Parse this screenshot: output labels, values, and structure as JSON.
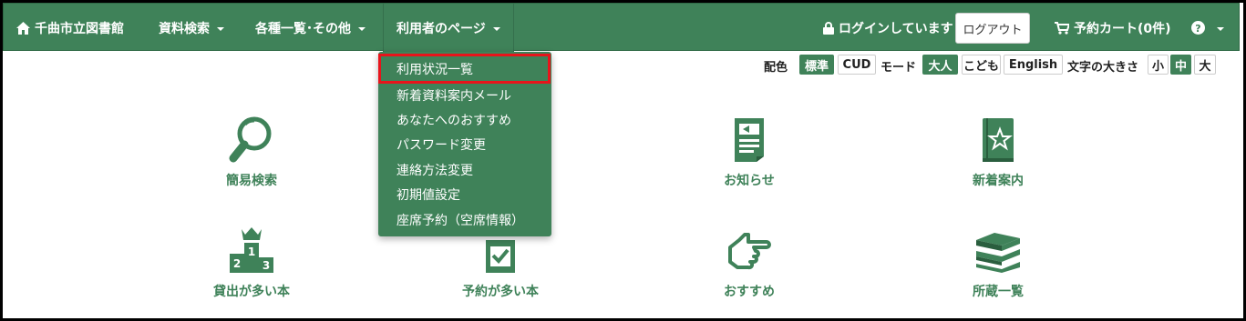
{
  "navbar": {
    "home_label": "千曲市立図書館",
    "menu_search": "資料検索",
    "menu_lists": "各種一覧･その他",
    "menu_user_page": "利用者のページ",
    "login_status": "ログインしています",
    "logout_label": "ログアウト",
    "cart_label": "予約カート(0件)"
  },
  "dropdown": {
    "items": [
      {
        "label": "利用状況一覧"
      },
      {
        "label": "新着資料案内メール"
      },
      {
        "label": "あなたへのおすすめ"
      },
      {
        "label": "パスワード変更"
      },
      {
        "label": "連絡方法変更"
      },
      {
        "label": "初期値設定"
      },
      {
        "label": "座席予約（空席情報）"
      }
    ]
  },
  "options": {
    "color_label": "配色",
    "color_standard": "標準",
    "color_cud": "CUD",
    "mode_label": "モード",
    "mode_adult": "大人",
    "mode_child": "こども",
    "mode_english": "English",
    "size_label": "文字の大きさ",
    "size_small": "小",
    "size_medium": "中",
    "size_large": "大"
  },
  "tiles": {
    "simple_search": "簡易検索",
    "notice": "お知らせ",
    "new_arrivals": "新着案内",
    "most_borrowed": "貸出が多い本",
    "most_reserved": "予約が多い本",
    "recommended": "おすすめ",
    "holdings": "所蔵一覧"
  },
  "colors": {
    "brand": "#3f8259",
    "highlight": "#e8141b"
  }
}
